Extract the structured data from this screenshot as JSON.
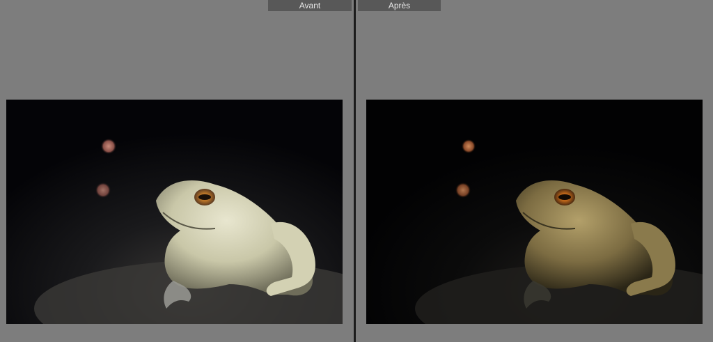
{
  "compare_view": {
    "before": {
      "label": "Avant",
      "photo_description": "toad"
    },
    "after": {
      "label": "Après",
      "photo_description": "toad"
    }
  },
  "colors": {
    "background": "#7d7d7d",
    "divider": "#1c1c1c",
    "tab_background": "#585858",
    "tab_text": "#e6e6e6"
  }
}
